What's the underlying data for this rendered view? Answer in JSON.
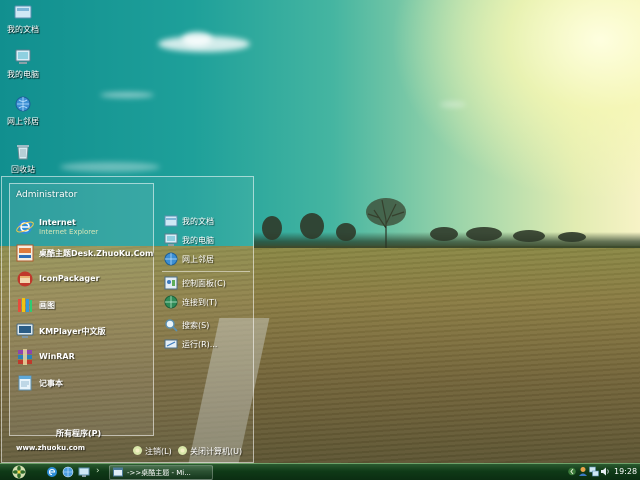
{
  "desktop": {
    "icons": [
      {
        "label": "我的文档",
        "icon": "my-documents-icon"
      },
      {
        "label": "我的电脑",
        "icon": "my-computer-icon"
      },
      {
        "label": "网上邻居",
        "icon": "network-places-icon"
      },
      {
        "label": "回收站",
        "icon": "recycle-bin-icon"
      }
    ]
  },
  "start_menu": {
    "user": "Administrator",
    "programs": [
      {
        "title": "Internet",
        "subtitle": "Internet Explorer",
        "icon": "internet-explorer-icon"
      },
      {
        "title": "桌酷主题Desk.ZhuoKu.Com",
        "subtitle": "",
        "icon": "zhuoku-icon"
      },
      {
        "title": "IconPackager",
        "subtitle": "",
        "icon": "iconpackager-icon"
      },
      {
        "title": "画图",
        "subtitle": "",
        "icon": "paint-icon"
      },
      {
        "title": "KMPlayer中文版",
        "subtitle": "",
        "icon": "kmplayer-icon"
      },
      {
        "title": "WinRAR",
        "subtitle": "",
        "icon": "winrar-icon"
      },
      {
        "title": "记事本",
        "subtitle": "",
        "icon": "notepad-icon"
      }
    ],
    "all_programs": "所有程序(P)",
    "site": "www.zhuoku.com",
    "places": [
      {
        "label": "我的文档",
        "icon": "my-documents-icon"
      },
      {
        "label": "我的电脑",
        "icon": "my-computer-icon"
      },
      {
        "label": "网上邻居",
        "icon": "network-places-icon"
      }
    ],
    "system": [
      {
        "label": "控制面板(C)",
        "icon": "control-panel-icon"
      },
      {
        "label": "连接到(T)",
        "icon": "connect-to-icon"
      },
      {
        "label": "搜索(S)",
        "icon": "search-icon"
      },
      {
        "label": "运行(R)...",
        "icon": "run-icon"
      }
    ],
    "logoff": "注销(L)",
    "shutdown": "关闭计算机(U)"
  },
  "taskbar": {
    "task_label": "->>桌酷主题 - Mi...",
    "clock": "19:28",
    "overflow_arrow": "›"
  },
  "colors": {
    "taskbar": "#0f3a17",
    "accent": "#6fa26a",
    "sky_teal": "#1ea09a"
  }
}
